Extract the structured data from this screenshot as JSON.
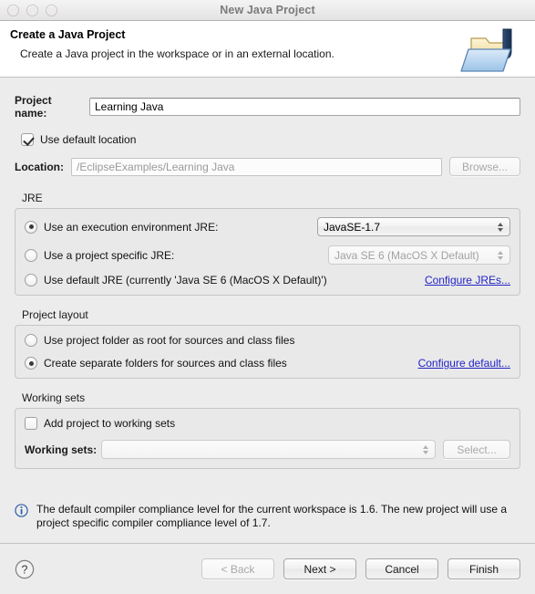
{
  "window": {
    "title": "New Java Project",
    "traffic_lights": [
      "close-button",
      "minimize-button",
      "zoom-button"
    ]
  },
  "header": {
    "title": "Create a Java Project",
    "subtitle": "Create a Java project in the workspace or in an external location.",
    "icon": "java-project-folder-icon"
  },
  "project_name": {
    "label": "Project name:",
    "value": "Learning Java",
    "placeholder": ""
  },
  "location": {
    "use_default_label": "Use default location",
    "use_default_checked": true,
    "label": "Location:",
    "value": "/EclipseExamples/Learning Java",
    "browse_label": "Browse..."
  },
  "jre": {
    "group_label": "JRE",
    "options": [
      {
        "label": "Use an execution environment JRE:",
        "selected": true,
        "combo_value": "JavaSE-1.7",
        "combo_enabled": true
      },
      {
        "label": "Use a project specific JRE:",
        "selected": false,
        "combo_value": "Java SE 6 (MacOS X Default)",
        "combo_enabled": false
      },
      {
        "label": "Use default JRE (currently 'Java SE 6 (MacOS X Default)')",
        "selected": false
      }
    ],
    "configure_link": "Configure JREs..."
  },
  "project_layout": {
    "group_label": "Project layout",
    "options": [
      {
        "label": "Use project folder as root for sources and class files",
        "selected": false
      },
      {
        "label": "Create separate folders for sources and class files",
        "selected": true
      }
    ],
    "configure_link": "Configure default..."
  },
  "working_sets": {
    "group_label": "Working sets",
    "add_label": "Add project to working sets",
    "add_checked": false,
    "label": "Working sets:",
    "combo_value": "",
    "select_label": "Select..."
  },
  "info": {
    "icon": "info-icon",
    "message": "The default compiler compliance level for the current workspace is 1.6. The new project will use a project specific compiler compliance level of 1.7."
  },
  "footer": {
    "help_label": "?",
    "buttons": [
      {
        "label": "< Back",
        "enabled": false
      },
      {
        "label": "Next >",
        "enabled": true
      },
      {
        "label": "Cancel",
        "enabled": true
      },
      {
        "label": "Finish",
        "enabled": true
      }
    ]
  },
  "colors": {
    "link": "#2323c8",
    "dialog_bg": "#ececec",
    "header_bg": "#ffffff",
    "info_icon": "#2d5fa8"
  }
}
